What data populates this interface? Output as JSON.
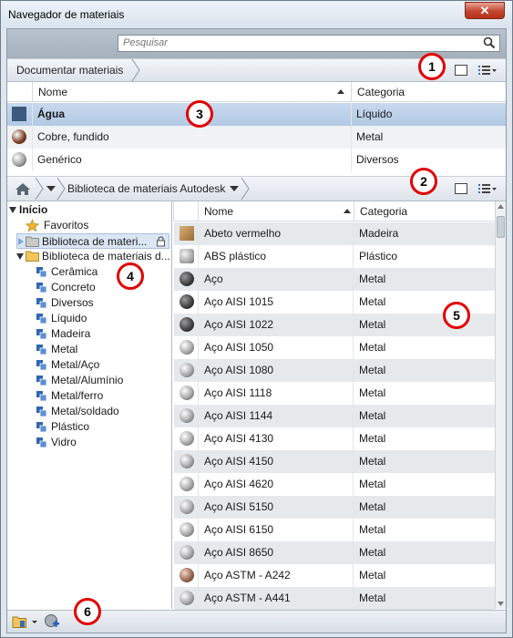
{
  "window": {
    "title": "Navegador de materiais",
    "close_label": "✕"
  },
  "search": {
    "placeholder": "Pesquisar"
  },
  "doc_toolbar": {
    "breadcrumb": "Documentar materiais"
  },
  "doc_table": {
    "headers": [
      "Nome",
      "Categoria"
    ],
    "rows": [
      {
        "name": "Água",
        "category": "Líquido",
        "selected": true,
        "color": "#3b5a7c"
      },
      {
        "name": "Cobre, fundido",
        "category": "Metal",
        "selected": false,
        "color": "#7a3a1e"
      },
      {
        "name": "Genérico",
        "category": "Diversos",
        "selected": false,
        "color": "#9a9a9a"
      }
    ]
  },
  "lib_toolbar": {
    "breadcrumb": "Biblioteca de materiais Autodesk"
  },
  "tree": {
    "root": "Início",
    "items": [
      {
        "label": "Favoritos",
        "icon": "star-icon"
      },
      {
        "label": "Biblioteca de materi...",
        "icon": "folder-icon",
        "selected": true,
        "locked": true
      },
      {
        "label": "Biblioteca de materiais d...",
        "icon": "folder-icon",
        "expanded": true
      }
    ],
    "categories": [
      "Cerâmica",
      "Concreto",
      "Diversos",
      "Líquido",
      "Madeira",
      "Metal",
      "Metal/Aço",
      "Metal/Alumínio",
      "Metal/ferro",
      "Metal/soldado",
      "Plástico",
      "Vidro"
    ]
  },
  "lib_table": {
    "headers": [
      "Nome",
      "Categoria"
    ],
    "rows": [
      {
        "name": "Abeto vermelho",
        "category": "Madeira",
        "icon": "wood"
      },
      {
        "name": "ABS plástico",
        "category": "Plástico",
        "icon": "plastic"
      },
      {
        "name": "Aço",
        "category": "Metal",
        "icon": "dark"
      },
      {
        "name": "Aço AISI 1015",
        "category": "Metal",
        "icon": "dark"
      },
      {
        "name": "Aço AISI 1022",
        "category": "Metal",
        "icon": "dark"
      },
      {
        "name": "Aço AISI 1050",
        "category": "Metal",
        "icon": "sphere"
      },
      {
        "name": "Aço AISI 1080",
        "category": "Metal",
        "icon": "sphere"
      },
      {
        "name": "Aço AISI 1118",
        "category": "Metal",
        "icon": "sphere"
      },
      {
        "name": "Aço AISI 1144",
        "category": "Metal",
        "icon": "sphere"
      },
      {
        "name": "Aço AISI 4130",
        "category": "Metal",
        "icon": "sphere"
      },
      {
        "name": "Aço AISI 4150",
        "category": "Metal",
        "icon": "sphere"
      },
      {
        "name": "Aço AISI 4620",
        "category": "Metal",
        "icon": "sphere"
      },
      {
        "name": "Aço AISI 5150",
        "category": "Metal",
        "icon": "sphere"
      },
      {
        "name": "Aço AISI 6150",
        "category": "Metal",
        "icon": "sphere"
      },
      {
        "name": "Aço AISI 8650",
        "category": "Metal",
        "icon": "sphere"
      },
      {
        "name": "Aço ASTM - A242",
        "category": "Metal",
        "icon": "copper"
      },
      {
        "name": "Aço ASTM - A441",
        "category": "Metal",
        "icon": "sphere"
      }
    ]
  },
  "callouts": [
    "1",
    "2",
    "3",
    "4",
    "5",
    "6"
  ]
}
